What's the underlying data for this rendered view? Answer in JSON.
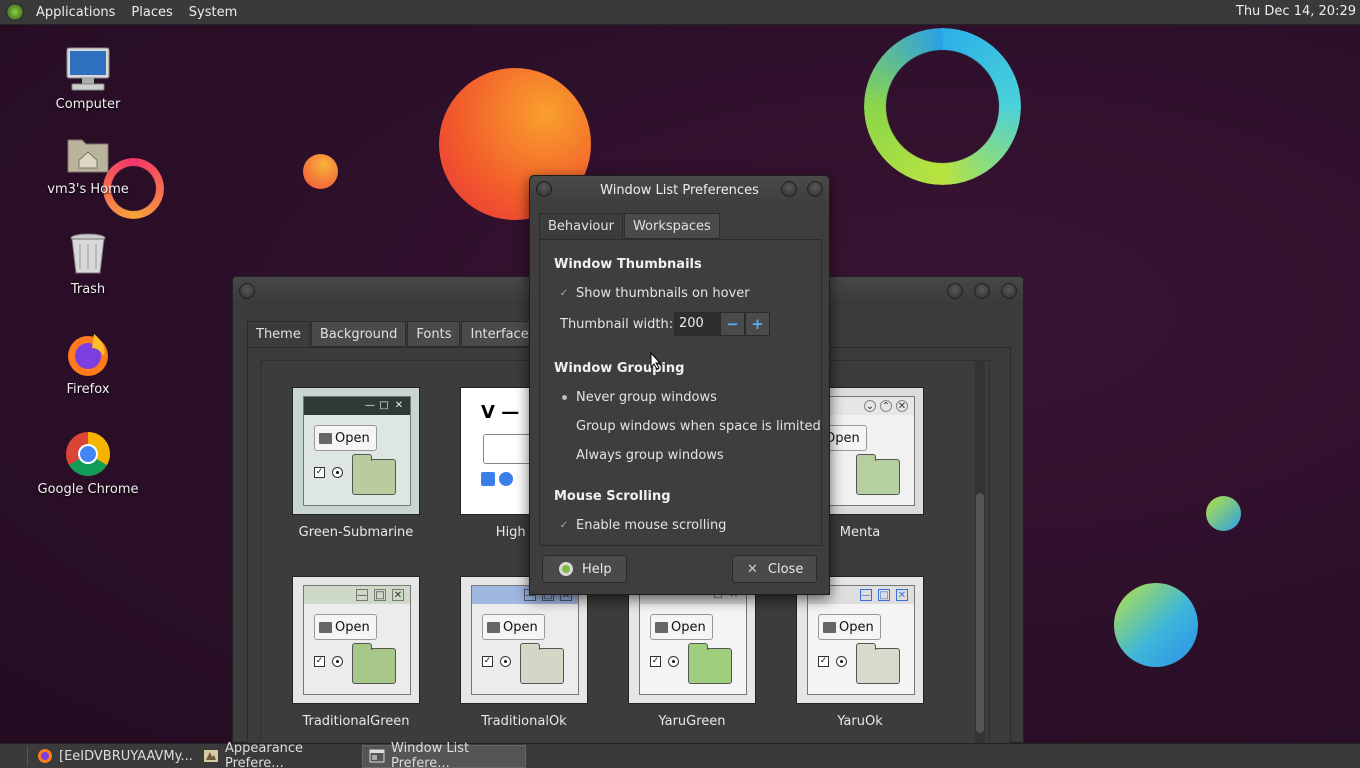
{
  "top_panel": {
    "menus": [
      "Applications",
      "Places",
      "System"
    ],
    "clock": "Thu Dec 14, 20:29"
  },
  "desktop_icons": [
    {
      "label": "Computer",
      "icon": "computer-icon"
    },
    {
      "label": "vm3's Home",
      "icon": "home-folder-icon"
    },
    {
      "label": "Trash",
      "icon": "trash-icon"
    },
    {
      "label": "Firefox",
      "icon": "firefox-icon"
    },
    {
      "label": "Google Chrome",
      "icon": "chrome-icon"
    }
  ],
  "appearance_window": {
    "tabs": [
      "Theme",
      "Background",
      "Fonts",
      "Interface"
    ],
    "themes": [
      "Green-Submarine",
      "High Cor",
      "Menta",
      "TraditionalGreen",
      "TraditionalOk",
      "YaruGreen",
      "YaruOk"
    ],
    "preview_open_label": "Open"
  },
  "dialog": {
    "title": "Window List Preferences",
    "tabs": [
      "Behaviour",
      "Workspaces"
    ],
    "thumbnails": {
      "heading": "Window Thumbnails",
      "show_on_hover": "Show thumbnails on hover",
      "width_label": "Thumbnail width:",
      "width_value": "200",
      "decrement": "−",
      "increment": "+"
    },
    "grouping": {
      "heading": "Window Grouping",
      "never": "Never group windows",
      "limited": "Group windows when space is limited",
      "always": "Always group windows",
      "selected": "never"
    },
    "scrolling": {
      "heading": "Mouse Scrolling",
      "enable": "Enable mouse scrolling"
    },
    "help_label": "Help",
    "close_label": "Close"
  },
  "taskbar": [
    {
      "label": "[EeIDVBRUYAAVMy...",
      "icon": "firefox-icon",
      "active": false
    },
    {
      "label": "Appearance Prefere...",
      "icon": "appearance-icon",
      "active": false
    },
    {
      "label": "Window List Prefere...",
      "icon": "window-list-icon",
      "active": true
    }
  ]
}
